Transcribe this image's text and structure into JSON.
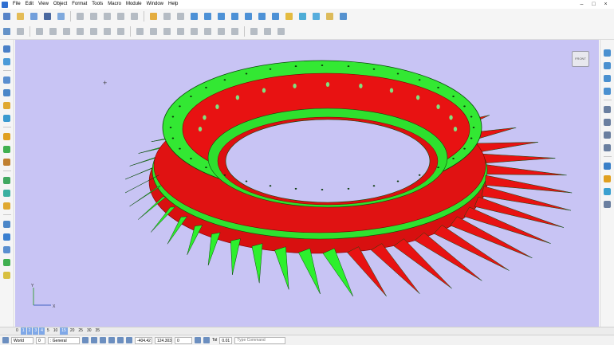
{
  "menu": [
    "File",
    "Edit",
    "View",
    "Object",
    "Format",
    "Tools",
    "Macro",
    "Module",
    "Window",
    "Help"
  ],
  "window_controls": {
    "minimize": "–",
    "maximize": "□",
    "close": "×"
  },
  "viewport": {
    "background": "#c8c4f4",
    "view_cube_label": "FRONT",
    "crosshair": "+",
    "axis_x": "X",
    "axis_y": "Y"
  },
  "model_colors": {
    "blade": "#2df02d",
    "ring": "#e81212",
    "flange": "#33e833",
    "outline": "#0a4a0a"
  },
  "layer_tabs": [
    "0",
    "1",
    "2",
    "3",
    "4",
    "5",
    "10",
    "15",
    "20",
    "25",
    "30",
    "35"
  ],
  "active_layers": [
    1,
    2,
    3,
    4,
    7
  ],
  "bottom": {
    "coord_system": "World",
    "layer_value": "0",
    "style": ": General",
    "x_value": "-404.42",
    "y_value": "124.303",
    "z_value": "0",
    "tol_label": "Tol",
    "tol_value": "0.01",
    "command_placeholder": "Type Command"
  }
}
